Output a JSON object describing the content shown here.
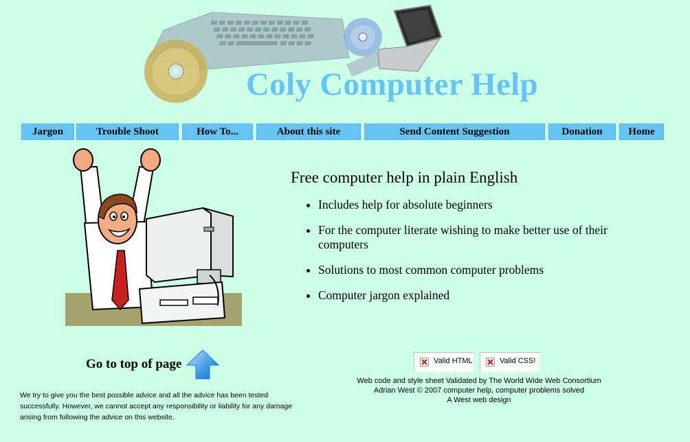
{
  "site": {
    "title": "Coly Computer Help"
  },
  "nav": {
    "items": [
      {
        "label": "Jargon"
      },
      {
        "label": "Trouble Shoot"
      },
      {
        "label": "How To..."
      },
      {
        "label": "About this site"
      },
      {
        "label": "Send Content Suggestion"
      },
      {
        "label": "Donation"
      },
      {
        "label": "Home"
      }
    ]
  },
  "main": {
    "tagline": "Free computer help in plain English",
    "features": [
      "Includes help for absolute beginners",
      "For the computer literate wishing to make better use of their computers",
      "Solutions to most common computer problems",
      "Computer jargon explained"
    ],
    "images": {
      "header_art": "laptop-keyboard-cd-collage",
      "clipart": "cheering-man-with-computer"
    }
  },
  "footer": {
    "goto_top_label": "Go to top of page",
    "goto_top_icon": "up-arrow-icon",
    "disclaimer": "We try to give you the best possible advice and all the advice has been tested successfully. However, we cannot accept any responsibility or liability for any damage arising from following the advice on this website.",
    "badges": [
      {
        "label": "Valid HTML",
        "icon": "broken-image-icon"
      },
      {
        "label": "Valid CSS!",
        "icon": "broken-image-icon"
      }
    ],
    "credits": [
      "Web code and style sheet Validated by The World Wide Web Consortium",
      "Adrian West  © 2007 computer help, computer problems solved",
      "A West web design"
    ]
  },
  "colors": {
    "background": "#ccffe6",
    "accent": "#66c4f5",
    "text": "#000000"
  }
}
